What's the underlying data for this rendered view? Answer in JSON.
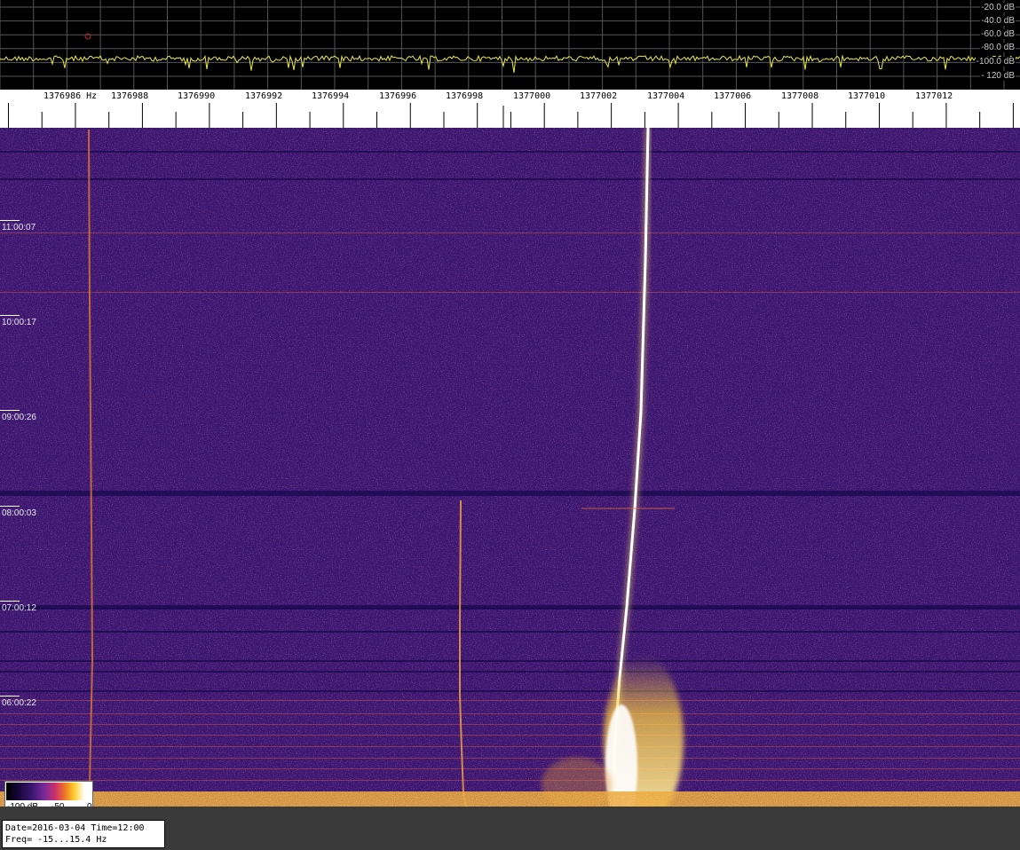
{
  "spectrum": {
    "db_labels": [
      "-20.0 dB",
      "-40.0 dB",
      "-60.0 dB",
      "-80.0 dB",
      "-100.0 dB",
      "- 120 dB"
    ],
    "trace_color": "#e8e84a",
    "marker_color": "#c02020"
  },
  "axis": {
    "freq_labels": [
      "1376986 Hz",
      "1376988",
      "1376990",
      "1376992",
      "1376994",
      "1376996",
      "1376998",
      "1377000",
      "1377002",
      "1377004",
      "1377006",
      "1377008",
      "1377010",
      "1377012"
    ]
  },
  "waterfall": {
    "time_labels": [
      "11:00:07",
      "10:00:17",
      "09:00:26",
      "08:00:03",
      "07:00:12",
      "06:00:22"
    ],
    "background_color": "#3a1670",
    "signal_colors": [
      "#f08020",
      "#ffd030",
      "#ffffff"
    ]
  },
  "colorscale": {
    "min_label": "-100 dB",
    "mid_label": "-50",
    "max_label": "0"
  },
  "info": {
    "line1": "Date=2016-03-04 Time=12:00",
    "line2": "Freq= -15...15.4 Hz"
  }
}
